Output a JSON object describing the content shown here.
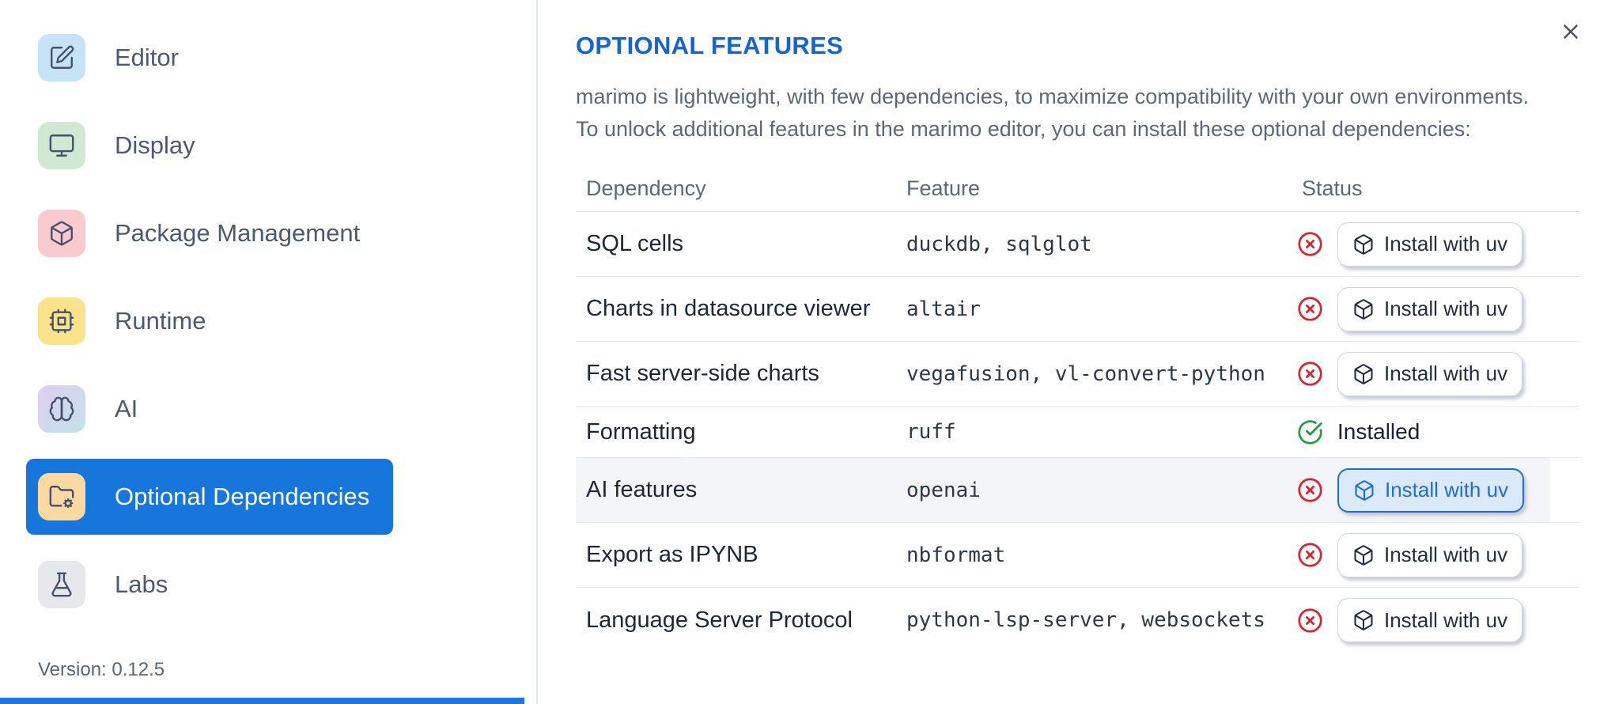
{
  "sidebar": {
    "items": [
      {
        "label": "Editor",
        "icon": "pencil-square-icon",
        "tile_color": "#c7e3f9"
      },
      {
        "label": "Display",
        "icon": "monitor-icon",
        "tile_color": "#cfe9d2"
      },
      {
        "label": "Package Management",
        "icon": "package-icon",
        "tile_color": "#f9cbce"
      },
      {
        "label": "Runtime",
        "icon": "cpu-icon",
        "tile_color": "#fbe38b"
      },
      {
        "label": "AI",
        "icon": "brain-icon",
        "tile_color": "purple-teal-gradient"
      },
      {
        "label": "Optional Dependencies",
        "icon": "folder-cog-icon",
        "tile_color": "#fbd9a1",
        "selected": true
      },
      {
        "label": "Labs",
        "icon": "flask-icon",
        "tile_color": "#e7e8ec"
      }
    ],
    "version_label": "Version: 0.12.5"
  },
  "dialog": {
    "title": "OPTIONAL FEATURES",
    "description_line1": "marimo is lightweight, with few dependencies, to maximize compatibility with your own environments.",
    "description_line2": "To unlock additional features in the marimo editor, you can install these optional dependencies:"
  },
  "table": {
    "columns": [
      "Dependency",
      "Feature",
      "Status"
    ],
    "rows": [
      {
        "dependency": "SQL cells",
        "feature": "duckdb, sqlglot",
        "installed": false,
        "action": "Install with uv"
      },
      {
        "dependency": "Charts in datasource viewer",
        "feature": "altair",
        "installed": false,
        "action": "Install with uv"
      },
      {
        "dependency": "Fast server-side charts",
        "feature": "vegafusion, vl-convert-python",
        "installed": false,
        "action": "Install with uv"
      },
      {
        "dependency": "Formatting",
        "feature": "ruff",
        "installed": true,
        "status_label": "Installed"
      },
      {
        "dependency": "AI features",
        "feature": "openai",
        "installed": false,
        "action": "Install with uv",
        "highlighted": true
      },
      {
        "dependency": "Export as IPYNB",
        "feature": "nbformat",
        "installed": false,
        "action": "Install with uv"
      },
      {
        "dependency": "Language Server Protocol",
        "feature": "python-lsp-server, websockets",
        "installed": false,
        "action": "Install with uv"
      }
    ]
  },
  "colors": {
    "selected_item_blue": "#1776db",
    "heading_blue": "#1464d1",
    "danger_red": "#d7262f",
    "success_green": "#229c3e",
    "highlight_row": "#f4f5f8",
    "focused_button_bg": "#dbe9fd",
    "focused_button_border": "#1e6fd9"
  }
}
